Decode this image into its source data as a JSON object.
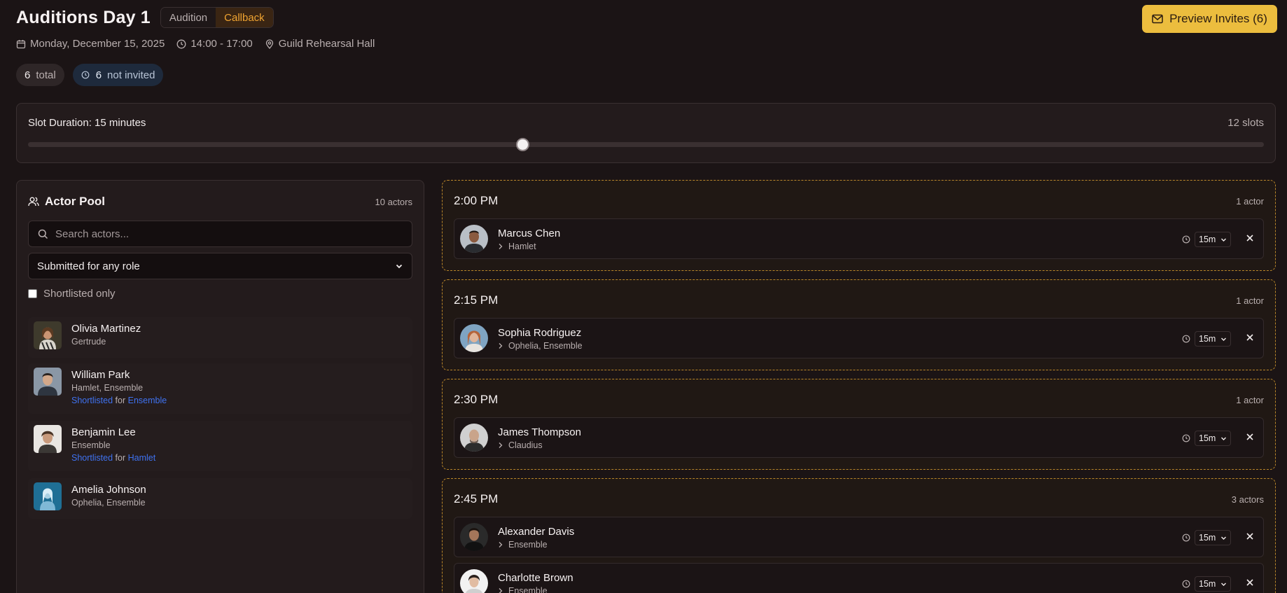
{
  "header": {
    "title": "Auditions Day 1",
    "modes": [
      "Audition",
      "Callback"
    ],
    "active_mode": "Callback",
    "date": "Monday, December 15, 2025",
    "time": "14:00 - 17:00",
    "location": "Guild Rehearsal Hall",
    "preview_label": "Preview Invites (6)"
  },
  "stats": {
    "total_count": "6",
    "total_label": "total",
    "not_invited_count": "6",
    "not_invited_label": "not invited"
  },
  "slot_duration": {
    "label": "Slot Duration: 15 minutes",
    "slots": "12 slots",
    "slider_fraction": 0.4
  },
  "pool": {
    "title": "Actor Pool",
    "count": "10 actors",
    "search_placeholder": "Search actors...",
    "filter": "Submitted for any role",
    "shortlisted_only": "Shortlisted only",
    "actors": [
      {
        "name": "Olivia Martinez",
        "roles": "Gertrude"
      },
      {
        "name": "William Park",
        "roles": "Hamlet, Ensemble",
        "shortlisted": "Shortlisted",
        "for_word": "for",
        "for_role": "Ensemble"
      },
      {
        "name": "Benjamin Lee",
        "roles": "Ensemble",
        "shortlisted": "Shortlisted",
        "for_word": "for",
        "for_role": "Hamlet"
      },
      {
        "name": "Amelia Johnson",
        "roles": "Ophelia, Ensemble"
      }
    ]
  },
  "schedule": [
    {
      "time": "2:00 PM",
      "count": "1 actor",
      "bookings": [
        {
          "name": "Marcus Chen",
          "role": "Hamlet",
          "duration": "15m"
        }
      ]
    },
    {
      "time": "2:15 PM",
      "count": "1 actor",
      "bookings": [
        {
          "name": "Sophia Rodriguez",
          "role": "Ophelia, Ensemble",
          "duration": "15m"
        }
      ]
    },
    {
      "time": "2:30 PM",
      "count": "1 actor",
      "bookings": [
        {
          "name": "James Thompson",
          "role": "Claudius",
          "duration": "15m"
        }
      ]
    },
    {
      "time": "2:45 PM",
      "count": "3 actors",
      "bookings": [
        {
          "name": "Alexander Davis",
          "role": "Ensemble",
          "duration": "15m"
        },
        {
          "name": "Charlotte Brown",
          "role": "Ensemble",
          "duration": "15m"
        }
      ]
    }
  ],
  "colors": {
    "accent": "#ecbd3e",
    "callback": "#f0a431",
    "link_blue": "#3f72f0",
    "slot_border": "#b9862a"
  }
}
